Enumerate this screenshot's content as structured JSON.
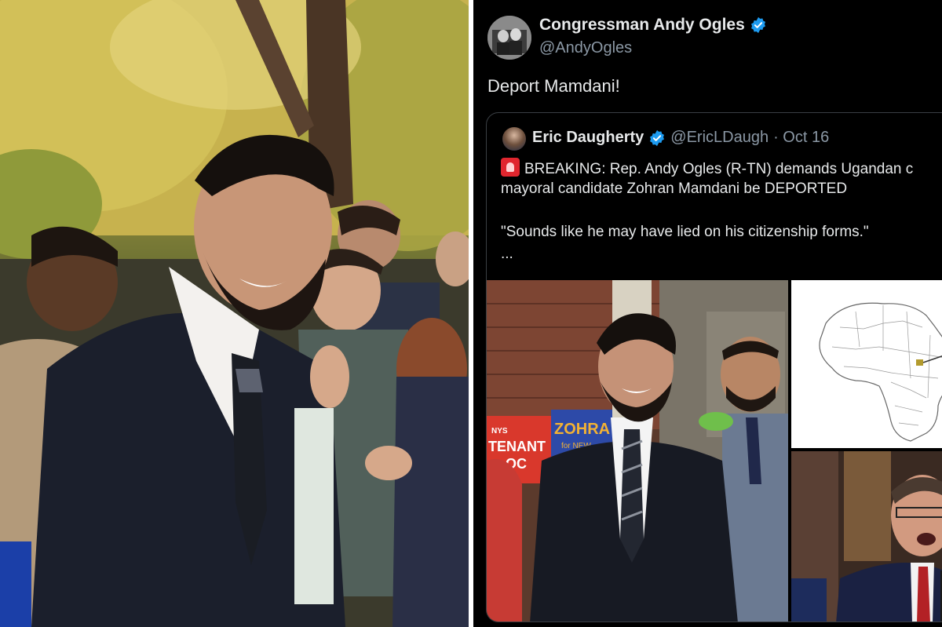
{
  "tweet": {
    "author_name": "Congressman Andy Ogles",
    "author_handle": "@AndyOgles",
    "text": "Deport Mamdani!",
    "quoted": {
      "author_name": "Eric Daugherty",
      "author_handle": "@EricLDaugh",
      "date": "· Oct 16",
      "line1": "BREAKING: Rep. Andy Ogles (R-TN) demands Ugandan c",
      "line2": "mayoral candidate Zohran Mamdani be DEPORTED",
      "line3": "\"Sounds like he may have lied on his citizenship forms.\"",
      "ellipsis": "...",
      "media": {
        "sign_left_line1": "NYS",
        "sign_left_line2": "TENANT",
        "sign_left_line3": "OC",
        "sign_right_line1": "ZOHRA",
        "sign_right_line2": "for NEW"
      }
    }
  },
  "colors": {
    "verified": "#1d9bf0",
    "background": "#000000",
    "secondary_text": "#8b98a5"
  },
  "icons": {
    "verified": "verified-badge-icon",
    "siren": "rotating-light-icon"
  }
}
